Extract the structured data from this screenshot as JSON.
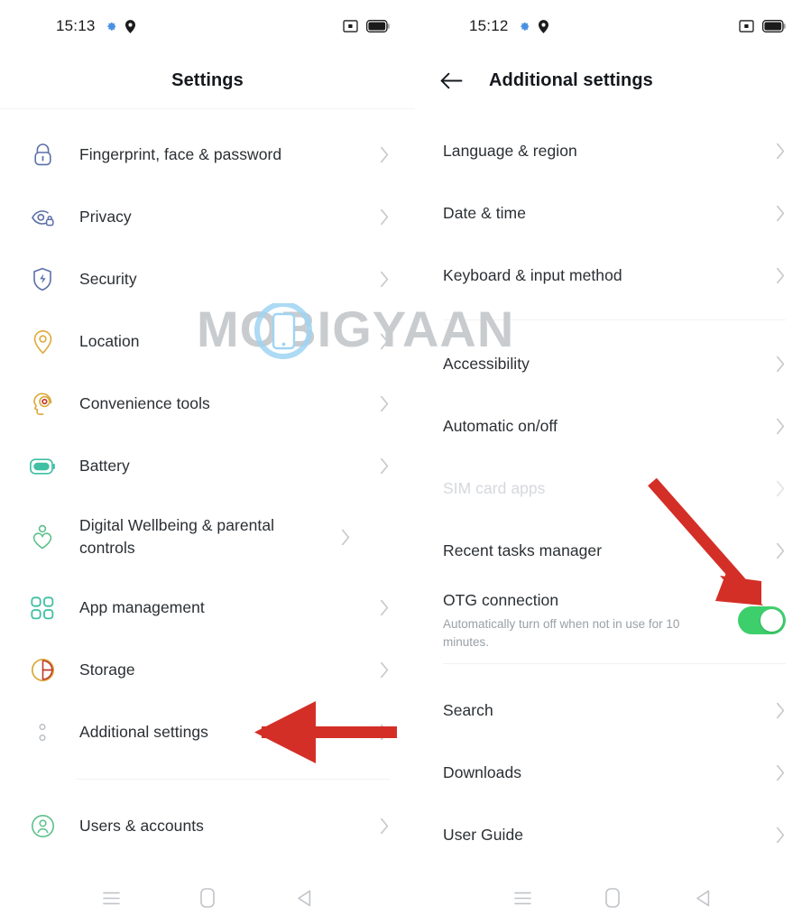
{
  "colors": {
    "accent_red": "#d32f27",
    "toggle_on": "#3ecf6d",
    "text_primary": "#2b2f33",
    "text_disabled": "#d5d8dc",
    "chevron": "#c7cacd",
    "icon_blue": "#5b6fa8",
    "icon_amber": "#e0a93b",
    "icon_teal": "#3fbfa4",
    "icon_green": "#5cc08a",
    "icon_gold": "#d8a93a",
    "icon_gray": "#b9bec4",
    "watermark_gray": "#c9cccf",
    "watermark_blue": "#9fd4f2"
  },
  "watermark": {
    "text": "MOBIGYAAN"
  },
  "left_screen": {
    "statusbar": {
      "time": "15:13",
      "icons": [
        "gear-icon",
        "location-pin-icon"
      ],
      "right_icons": [
        "dnd-icon",
        "battery-icon"
      ]
    },
    "header": {
      "title": "Settings"
    },
    "items": [
      {
        "label": "Fingerprint, face & password",
        "icon": "lock-icon",
        "color": "#5b6fa8"
      },
      {
        "label": "Privacy",
        "icon": "privacy-eye-icon",
        "color": "#5b6fa8"
      },
      {
        "label": "Security",
        "icon": "shield-bolt-icon",
        "color": "#5b6fa8"
      },
      {
        "label": "Location",
        "icon": "location-pin-icon",
        "color": "#e0a93b"
      },
      {
        "label": "Convenience tools",
        "icon": "head-gear-icon",
        "color": "#d8a93a"
      },
      {
        "label": "Battery",
        "icon": "battery-icon",
        "color": "#3fbfa4"
      },
      {
        "label": "Digital Wellbeing & parental controls",
        "icon": "heart-person-icon",
        "color": "#5cc08a"
      },
      {
        "label": "App management",
        "icon": "grid-apps-icon",
        "color": "#3fbfa4"
      },
      {
        "label": "Storage",
        "icon": "pie-chart-icon",
        "color": "#d8a93a"
      },
      {
        "label": "Additional settings",
        "icon": "dots-vertical-icon",
        "color": "#b9bec4"
      },
      {
        "label": "Users & accounts",
        "icon": "user-circle-icon",
        "color": "#5cc08a"
      }
    ],
    "divider_after_index": 9,
    "navbar": [
      "menu-icon",
      "home-icon",
      "back-icon"
    ]
  },
  "right_screen": {
    "statusbar": {
      "time": "15:12",
      "icons": [
        "gear-icon",
        "location-pin-icon"
      ],
      "right_icons": [
        "dnd-icon",
        "battery-icon"
      ]
    },
    "header": {
      "title": "Additional settings",
      "back": "back-arrow-icon"
    },
    "group_one": [
      {
        "label": "Language & region"
      },
      {
        "label": "Date & time"
      },
      {
        "label": "Keyboard & input method"
      }
    ],
    "group_two": [
      {
        "label": "Accessibility"
      },
      {
        "label": "Automatic on/off"
      },
      {
        "label": "SIM card apps",
        "disabled": true
      },
      {
        "label": "Recent tasks manager"
      }
    ],
    "otg": {
      "label": "OTG connection",
      "sub": "Automatically turn off when not in use for 10 minutes.",
      "toggle_state": "on"
    },
    "group_three": [
      {
        "label": "Search"
      },
      {
        "label": "Downloads"
      },
      {
        "label": "User Guide"
      }
    ],
    "navbar": [
      "menu-icon",
      "home-icon",
      "back-icon"
    ]
  },
  "annotations": [
    {
      "name": "arrow-to-additional-settings",
      "direction": "left",
      "target": "Additional settings"
    },
    {
      "name": "arrow-to-otg-toggle",
      "direction": "down-right",
      "target": "OTG connection toggle"
    }
  ]
}
